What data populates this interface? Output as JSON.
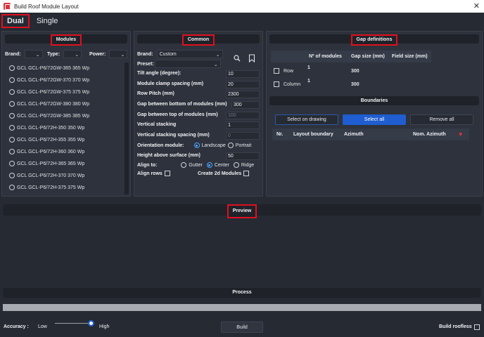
{
  "window": {
    "title": "Build Roof Module Layout",
    "close": "✕"
  },
  "tabs": {
    "dual": "Dual",
    "single": "Single"
  },
  "modules": {
    "header": "Modules",
    "brand_label": "Brand:",
    "type_label": "Type:",
    "power_label": "Power:",
    "items": [
      "GCL GCL-P6/72GW-365 365 Wp",
      "GCL GCL-P6/72GW-370 370 Wp",
      "GCL GCL-P6/72GW-375 375 Wp",
      "GCL GCL-P6/72GW-380 380 Wp",
      "GCL GCL-P6/72GW-385 385 Wp",
      "GCL GCL-P6/72H-350 350 Wp",
      "GCL GCL-P6/72H-355 355 Wp",
      "GCL GCL-P6/72H-360 360 Wp",
      "GCL GCL-P6/72H-365 365 Wp",
      "GCL GCL-P6/72H-370 370 Wp",
      "GCL GCL-P6/72H-375 375 Wp"
    ]
  },
  "common": {
    "header": "Common",
    "brand_label": "Brand:",
    "brand_value": "Custom",
    "preset_label": "Preset:",
    "fields": [
      {
        "label": "Tilt angle (degree):",
        "value": "10",
        "disabled": false
      },
      {
        "label": "Module clamp spacing (mm)",
        "value": "20",
        "disabled": false
      },
      {
        "label": "Row Pitch (mm)",
        "value": "2300",
        "disabled": false
      },
      {
        "label": "Gap between bottom of modules (mm)",
        "value": "300",
        "disabled": false
      },
      {
        "label": "Gap between top of modules (mm)",
        "value": "100",
        "disabled": true
      },
      {
        "label": "Vertical stacking",
        "value": "1",
        "disabled": false
      },
      {
        "label": "Vertical stacking spacing (mm)",
        "value": "0",
        "disabled": true
      }
    ],
    "orientation_label": "Orientation module:",
    "orientation_landscape": "Landscape",
    "orientation_portrait": "Portrait",
    "height_label": "Height above surface (mm)",
    "height_value": "50",
    "align_label": "Align to:",
    "align_gutter": "Gutter",
    "align_center": "Center",
    "align_ridge": "Ridge",
    "align_rows_label": "Align rows",
    "create_2d_label": "Create 2d Modules"
  },
  "gap": {
    "header": "Gap definitions",
    "col_modules": "Nº of modules",
    "col_gap": "Gap size (mm)",
    "col_field": "Field size (mm)",
    "rows": [
      {
        "label": "Row",
        "modules": "1",
        "gap": "300"
      },
      {
        "label": "Column",
        "modules": "1",
        "gap": "300"
      }
    ]
  },
  "boundaries": {
    "header": "Boundaries",
    "select_on_drawing": "Select on drawing",
    "select_all": "Select all",
    "remove_all": "Remove all",
    "col_nr": "Nr.",
    "col_layout": "Layout boundary",
    "col_azimuth": "Azimuth",
    "col_nom": "Nom. Azimuth",
    "heart": "♥"
  },
  "preview": {
    "label": "Preview"
  },
  "process": {
    "label": "Process"
  },
  "footer": {
    "accuracy_label": "Accuracy :",
    "low": "Low",
    "high": "High",
    "accuracy_level": 1.0,
    "build": "Build",
    "build_roofless": "Build roofless"
  },
  "colors": {
    "accent": "#1f5dd1",
    "highlight": "#e01020",
    "heart": "#e0303a"
  }
}
